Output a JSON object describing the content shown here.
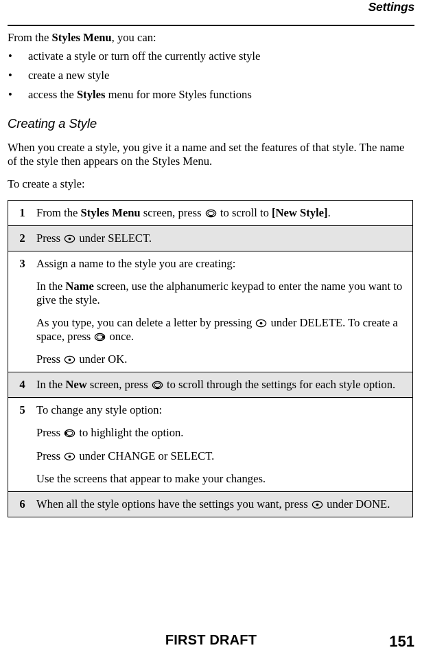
{
  "header": {
    "title": "Settings"
  },
  "intro": {
    "lead_pre": "From the ",
    "lead_bold": "Styles Menu",
    "lead_post": ", you can:",
    "bullet_char": "•",
    "bullets": [
      {
        "text": "activate a style or turn off the currently active style"
      },
      {
        "text": "create a new style"
      },
      {
        "pre": "access the ",
        "bold": "Styles",
        "post": " menu for more Styles functions"
      }
    ]
  },
  "section": {
    "heading": "Creating a Style",
    "paragraph": "When you create a style, you give it a name and set the features of that style. The name of the style then appears on the Styles Menu.",
    "lead_in": "To create a style:"
  },
  "steps": [
    {
      "number": "1",
      "shaded": false,
      "blocks": [
        {
          "parts": [
            {
              "type": "text",
              "value": "From the "
            },
            {
              "type": "bold",
              "value": "Styles Menu"
            },
            {
              "type": "text",
              "value": " screen, press "
            },
            {
              "type": "icon",
              "value": "nav-wheel-down-icon"
            },
            {
              "type": "text",
              "value": " to scroll to "
            },
            {
              "type": "bold",
              "value": "[New Style]"
            },
            {
              "type": "text",
              "value": "."
            }
          ]
        }
      ]
    },
    {
      "number": "2",
      "shaded": true,
      "blocks": [
        {
          "parts": [
            {
              "type": "text",
              "value": "Press "
            },
            {
              "type": "icon",
              "value": "menu-key-icon"
            },
            {
              "type": "text",
              "value": " under SELECT."
            }
          ]
        }
      ]
    },
    {
      "number": "3",
      "shaded": false,
      "blocks": [
        {
          "parts": [
            {
              "type": "text",
              "value": "Assign a name to the style you are creating:"
            }
          ]
        },
        {
          "parts": [
            {
              "type": "text",
              "value": "In the "
            },
            {
              "type": "bold",
              "value": "Name"
            },
            {
              "type": "text",
              "value": " screen, use the alphanumeric keypad to enter the name you want to give the style."
            }
          ]
        },
        {
          "parts": [
            {
              "type": "text",
              "value": "As you type, you can delete a letter by pressing "
            },
            {
              "type": "icon",
              "value": "menu-key-icon"
            },
            {
              "type": "text",
              "value": " under DELETE. To create a space, press "
            },
            {
              "type": "icon",
              "value": "nav-wheel-right-icon"
            },
            {
              "type": "text",
              "value": " once."
            }
          ]
        },
        {
          "parts": [
            {
              "type": "text",
              "value": "Press "
            },
            {
              "type": "icon",
              "value": "menu-key-icon"
            },
            {
              "type": "text",
              "value": " under OK."
            }
          ]
        }
      ]
    },
    {
      "number": "4",
      "shaded": true,
      "blocks": [
        {
          "parts": [
            {
              "type": "text",
              "value": "In the "
            },
            {
              "type": "bold",
              "value": "New"
            },
            {
              "type": "text",
              "value": " screen, press "
            },
            {
              "type": "icon",
              "value": "nav-wheel-down-icon"
            },
            {
              "type": "text",
              "value": " to scroll through the settings for each style option."
            }
          ]
        }
      ]
    },
    {
      "number": "5",
      "shaded": false,
      "blocks": [
        {
          "parts": [
            {
              "type": "text",
              "value": "To change any style option:"
            }
          ]
        },
        {
          "parts": [
            {
              "type": "text",
              "value": "Press "
            },
            {
              "type": "icon",
              "value": "nav-wheel-left-icon"
            },
            {
              "type": "text",
              "value": " to highlight the option."
            }
          ]
        },
        {
          "parts": [
            {
              "type": "text",
              "value": "Press "
            },
            {
              "type": "icon",
              "value": "menu-key-icon"
            },
            {
              "type": "text",
              "value": " under CHANGE or SELECT."
            }
          ]
        },
        {
          "parts": [
            {
              "type": "text",
              "value": "Use the screens that appear to make your changes."
            }
          ]
        }
      ]
    },
    {
      "number": "6",
      "shaded": true,
      "blocks": [
        {
          "parts": [
            {
              "type": "text",
              "value": "When all the style options have the settings you want, press "
            },
            {
              "type": "icon",
              "value": "menu-key-icon"
            },
            {
              "type": "text",
              "value": " under DONE."
            }
          ]
        }
      ]
    }
  ],
  "footer": {
    "center_label": "FIRST DRAFT",
    "page_number": "151"
  }
}
